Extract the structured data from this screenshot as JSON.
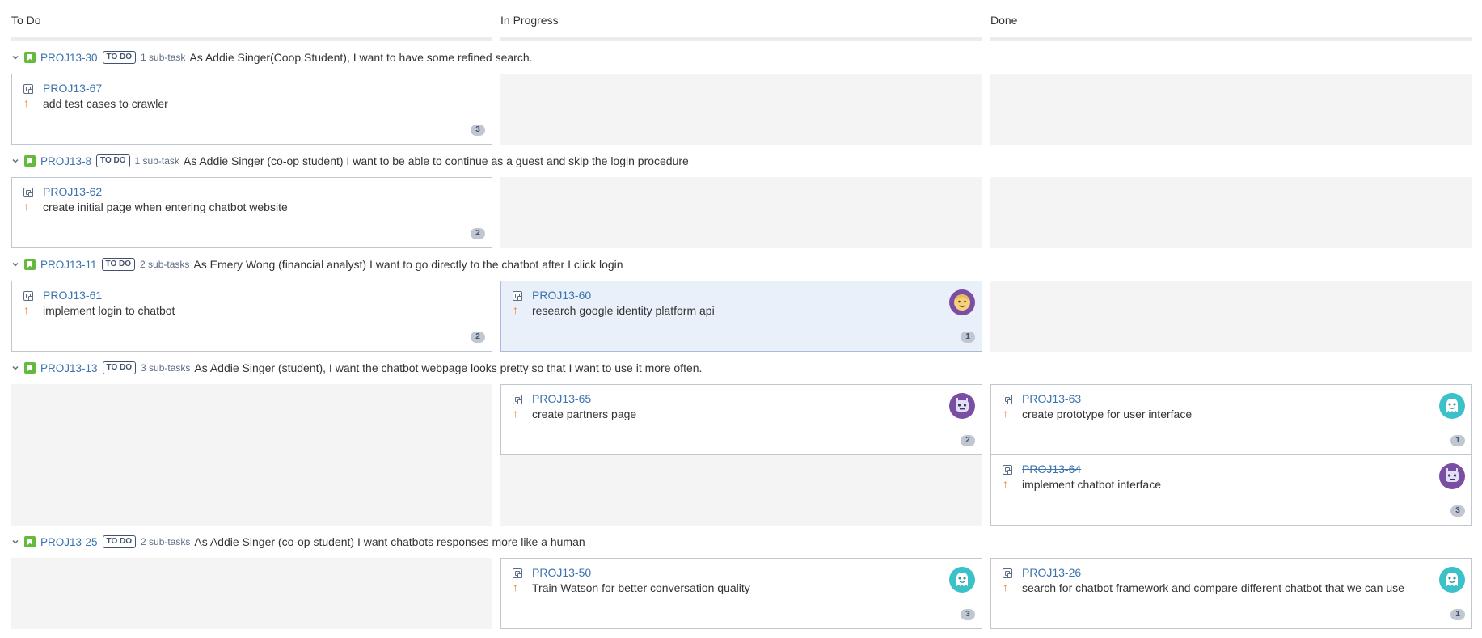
{
  "columns": [
    {
      "label": "To Do"
    },
    {
      "label": "In Progress"
    },
    {
      "label": "Done"
    }
  ],
  "colors": {
    "story_green": "#63ba3c",
    "link_blue": "#3b73af",
    "priority_orange": "#f07f26",
    "empty_cell": "#f4f4f4",
    "selected_card": "#e9f0f9"
  },
  "swimlanes": [
    {
      "key": "PROJ13-30",
      "status": "TO DO",
      "subtasks": "1 sub-task",
      "summary": "As Addie Singer(Coop Student), I want to have some refined search.",
      "cards": [
        {
          "key": "PROJ13-67",
          "summary": "add test cases to crawler",
          "points": "3",
          "column": "todo"
        }
      ]
    },
    {
      "key": "PROJ13-8",
      "status": "TO DO",
      "subtasks": "1 sub-task",
      "summary": "As Addie Singer (co-op student) I want to be able to continue as a guest and skip the login procedure",
      "cards": [
        {
          "key": "PROJ13-62",
          "summary": "create initial page when entering chatbot website",
          "points": "2",
          "column": "todo"
        }
      ]
    },
    {
      "key": "PROJ13-11",
      "status": "TO DO",
      "subtasks": "2 sub-tasks",
      "summary": "As Emery Wong (financial analyst) I want to go directly to the chatbot after I click login",
      "cards": [
        {
          "key": "PROJ13-61",
          "summary": "implement login to chatbot",
          "points": "2",
          "column": "todo"
        },
        {
          "key": "PROJ13-60",
          "summary": "research google identity platform api",
          "points": "1",
          "column": "inprogress",
          "avatar": "avatar-face-icon"
        }
      ]
    },
    {
      "key": "PROJ13-13",
      "status": "TO DO",
      "subtasks": "3 sub-tasks",
      "summary": "As Addie Singer (student), I want the chatbot webpage looks pretty so that I want to use it more often.",
      "cards": [
        {
          "key": "PROJ13-65",
          "summary": "create partners page",
          "points": "2",
          "column": "inprogress",
          "avatar": "avatar-robot-purple-icon"
        },
        {
          "key": "PROJ13-63",
          "summary": "create prototype for user interface",
          "points": "1",
          "column": "done",
          "avatar": "avatar-ghost-teal-icon"
        },
        {
          "key": "PROJ13-64",
          "summary": "implement chatbot interface",
          "points": "3",
          "column": "done",
          "avatar": "avatar-robot-purple-icon"
        }
      ]
    },
    {
      "key": "PROJ13-25",
      "status": "TO DO",
      "subtasks": "2 sub-tasks",
      "summary": "As Addie Singer (co-op student) I want chatbots responses more like a human",
      "cards": [
        {
          "key": "PROJ13-50",
          "summary": "Train Watson for better conversation quality",
          "points": "3",
          "column": "inprogress",
          "avatar": "avatar-ghost-teal-icon"
        },
        {
          "key": "PROJ13-26",
          "summary": "search for chatbot framework and compare different chatbot that we can use",
          "points": "1",
          "column": "done",
          "avatar": "avatar-ghost-teal-icon"
        }
      ]
    }
  ]
}
